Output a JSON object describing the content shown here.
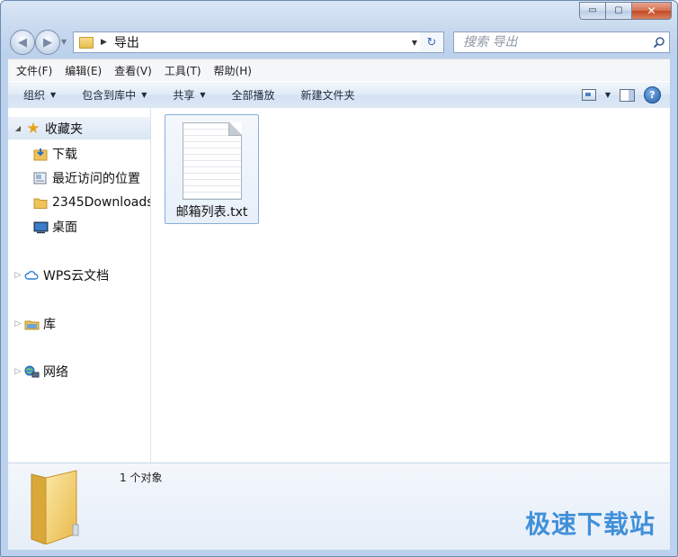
{
  "window": {
    "caption_buttons": {
      "minimize": "▭",
      "maximize": "▢",
      "close": "✕"
    }
  },
  "nav": {
    "back_glyph": "◀",
    "forward_glyph": "▶",
    "address": {
      "crumb_sep": "▶",
      "crumb": "导出",
      "dropdown": "▼"
    },
    "refresh_glyph": "↻",
    "search_placeholder": "搜索 导出"
  },
  "menubar": {
    "items": [
      "文件(F)",
      "编辑(E)",
      "查看(V)",
      "工具(T)",
      "帮助(H)"
    ]
  },
  "commandbar": {
    "items": [
      "组织",
      "包含到库中",
      "共享",
      "全部播放",
      "新建文件夹"
    ],
    "dropdown_arrow": "▼",
    "help": "?"
  },
  "sidebar": {
    "favorites": {
      "label": "收藏夹",
      "icon": "star-icon",
      "star": "★",
      "expand": "◢"
    },
    "fav_items": [
      {
        "label": "下载",
        "icon": "download-folder-icon"
      },
      {
        "label": "最近访问的位置",
        "icon": "recent-places-icon"
      },
      {
        "label": "2345Downloads",
        "icon": "folder-icon"
      },
      {
        "label": "桌面",
        "icon": "desktop-icon"
      }
    ],
    "groups": [
      {
        "label": "WPS云文档",
        "icon": "cloud-icon"
      },
      {
        "label": "库",
        "icon": "library-icon"
      },
      {
        "label": "网络",
        "icon": "network-icon"
      }
    ],
    "collapsed_arrow": "▷"
  },
  "main": {
    "files": [
      {
        "name": "邮箱列表.txt",
        "icon": "text-file-icon",
        "selected": true
      }
    ]
  },
  "details": {
    "count": "1 个对象"
  },
  "watermark": "极速下载站",
  "colors": {
    "accent": "#2f86d6",
    "selection": "#e8f0fa",
    "chrome": "#c7d8ee"
  }
}
